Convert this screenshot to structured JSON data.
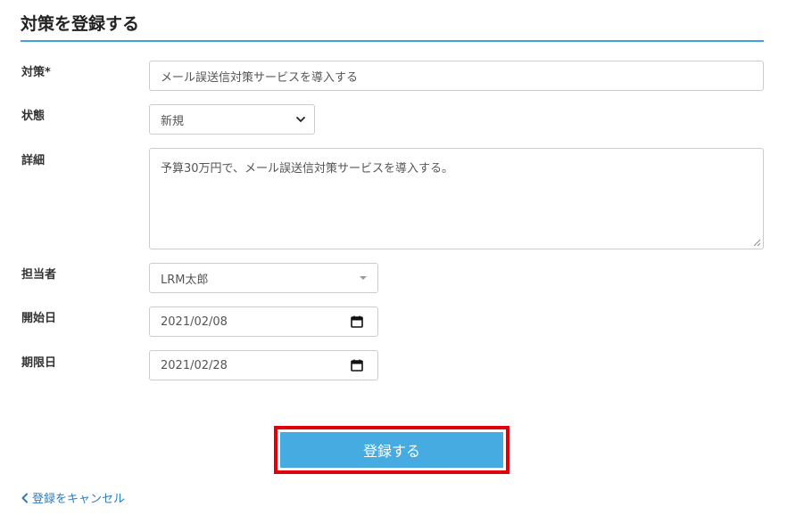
{
  "page": {
    "title": "対策を登録する"
  },
  "form": {
    "measure": {
      "label": "対策*",
      "value": "メール誤送信対策サービスを導入する"
    },
    "status": {
      "label": "状態",
      "value": "新規"
    },
    "detail": {
      "label": "詳細",
      "value": "予算30万円で、メール誤送信対策サービスを導入する。"
    },
    "assignee": {
      "label": "担当者",
      "value": "LRM太郎"
    },
    "start_date": {
      "label": "開始日",
      "value": "2021/02/08"
    },
    "due_date": {
      "label": "期限日",
      "value": "2021/02/28"
    }
  },
  "actions": {
    "submit_label": "登録する",
    "cancel_label": "登録をキャンセル"
  },
  "colors": {
    "accent": "#3fa3dc",
    "submit_bg": "#45abe0",
    "highlight_border": "#e0000b",
    "link": "#2b7bbf"
  },
  "icons": {
    "status_select": "chevron-down-icon",
    "assignee_select": "caret-down-icon",
    "date_picker": "calendar-icon",
    "cancel": "chevron-left-icon"
  }
}
